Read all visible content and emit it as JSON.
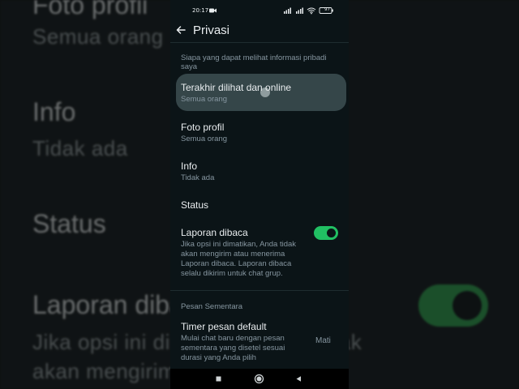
{
  "status_bar": {
    "time": "20:17",
    "battery": "97"
  },
  "header": {
    "title": "Privasi"
  },
  "sections": {
    "personal_info_header": "Siapa yang dapat melihat informasi pribadi saya",
    "disappearing_header": "Pesan Sementara"
  },
  "items": {
    "last_seen": {
      "title": "Terakhir dilihat dan online",
      "value": "Semua orang"
    },
    "profile_photo": {
      "title": "Foto profil",
      "value": "Semua orang"
    },
    "about": {
      "title": "Info",
      "value": "Tidak ada"
    },
    "status": {
      "title": "Status"
    },
    "read_receipts": {
      "title": "Laporan dibaca",
      "description": "Jika opsi ini dimatikan, Anda tidak akan mengirim atau menerima Laporan dibaca. Laporan dibaca selalu dikirim untuk chat grup.",
      "enabled": true
    },
    "default_timer": {
      "title": "Timer pesan default",
      "description": "Mulai chat baru dengan pesan sementara yang disetel sesuai durasi yang Anda pilih",
      "value": "Mati"
    }
  },
  "background": {
    "line1_title": "Foto profil",
    "line1_sub": "Semua orang",
    "line2_title": "Info",
    "line2_sub": "Tidak ada",
    "line3_title": "Status",
    "line4_title": "Laporan dibaca",
    "line4_sub1": "Jika opsi ini dimatikan, Anda tidak",
    "line4_sub2": "akan mengirim atau menerima"
  },
  "colors": {
    "accent_green": "#21c063",
    "panel_background": "#0b1417",
    "primary_text": "#e9edef",
    "secondary_text": "#8696a0"
  },
  "icons": {
    "back": "arrow-left-icon",
    "video": "video-camera-icon",
    "nav_recent": "square-icon",
    "nav_home": "circle-icon",
    "nav_back": "triangle-icon"
  }
}
